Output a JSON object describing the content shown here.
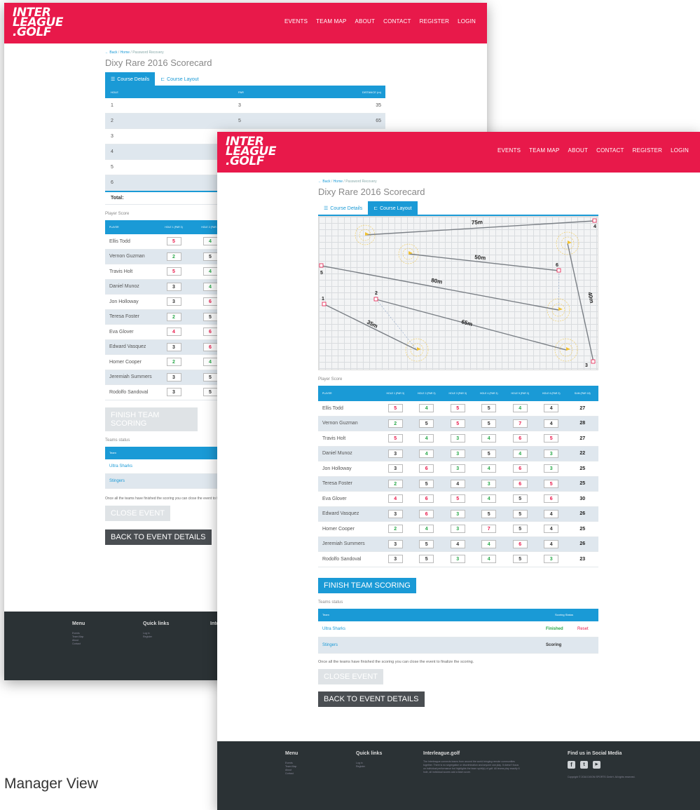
{
  "brand": {
    "line1": "INTER",
    "line2": "LEAGUE",
    "line3": ".GOLF"
  },
  "nav": [
    "EVENTS",
    "TEAM MAP",
    "ABOUT",
    "CONTACT",
    "REGISTER",
    "LOGIN"
  ],
  "breadcrumb": {
    "back": "Back",
    "sep": "/",
    "home": "Home",
    "current": "Password Recovery"
  },
  "page_title": "Dixy Rare 2016 Scorecard",
  "tabs": {
    "details": "Course Details",
    "layout": "Course Layout"
  },
  "course_table": {
    "headers": [
      "HOLE",
      "PAR",
      "DISTANCE (m)"
    ],
    "rows": [
      [
        "1",
        "3",
        "35"
      ],
      [
        "2",
        "5",
        "65"
      ],
      [
        "3",
        "",
        ""
      ],
      [
        "4",
        "",
        ""
      ],
      [
        "5",
        "",
        ""
      ],
      [
        "6",
        "",
        ""
      ]
    ],
    "total_label": "Total:"
  },
  "map_labels": {
    "d1": "75m",
    "d2": "50m",
    "d3": "80m",
    "d4": "65m",
    "d5": "35m",
    "d6": "40m",
    "h1": "1",
    "h2": "2",
    "h3": "3",
    "h4": "4",
    "h5": "5",
    "h6": "6"
  },
  "player_score_label": "Player Score",
  "score_headers": [
    "PLAYER",
    "HOLE 1 (PAR 3)",
    "HOLE 2 (PAR 3)",
    "HOLE 3 (PAR 3)",
    "HOLE 4 (PAR 3)",
    "HOLE 5 (PAR 3)",
    "HOLE 6 (PAR 3)",
    "SUM (PAR 18)"
  ],
  "players": [
    {
      "name": "Ellis Todd",
      "scores": [
        "5",
        "4",
        "5",
        "5",
        "4",
        "4"
      ],
      "colors": [
        "red",
        "green",
        "red",
        "dark",
        "green",
        "dark"
      ],
      "sum": "27"
    },
    {
      "name": "Vernon Guzman",
      "scores": [
        "2",
        "5",
        "5",
        "5",
        "7",
        "4"
      ],
      "colors": [
        "green",
        "dark",
        "red",
        "dark",
        "red",
        "dark"
      ],
      "sum": "28"
    },
    {
      "name": "Travis Holt",
      "scores": [
        "5",
        "4",
        "3",
        "4",
        "6",
        "5"
      ],
      "colors": [
        "red",
        "green",
        "green",
        "green",
        "red",
        "red"
      ],
      "sum": "27"
    },
    {
      "name": "Daniel Munoz",
      "scores": [
        "3",
        "4",
        "3",
        "5",
        "4",
        "3"
      ],
      "colors": [
        "dark",
        "green",
        "green",
        "dark",
        "green",
        "green"
      ],
      "sum": "22"
    },
    {
      "name": "Jon Holloway",
      "scores": [
        "3",
        "6",
        "3",
        "4",
        "6",
        "3"
      ],
      "colors": [
        "dark",
        "red",
        "green",
        "green",
        "red",
        "green"
      ],
      "sum": "25"
    },
    {
      "name": "Teresa Foster",
      "scores": [
        "2",
        "5",
        "4",
        "3",
        "6",
        "5"
      ],
      "colors": [
        "green",
        "dark",
        "dark",
        "green",
        "red",
        "red"
      ],
      "sum": "25"
    },
    {
      "name": "Eva Glover",
      "scores": [
        "4",
        "6",
        "5",
        "4",
        "5",
        "6"
      ],
      "colors": [
        "red",
        "red",
        "red",
        "green",
        "dark",
        "red"
      ],
      "sum": "30"
    },
    {
      "name": "Edward Vasquez",
      "scores": [
        "3",
        "6",
        "3",
        "5",
        "5",
        "4"
      ],
      "colors": [
        "dark",
        "red",
        "green",
        "dark",
        "dark",
        "dark"
      ],
      "sum": "26"
    },
    {
      "name": "Homer Cooper",
      "scores": [
        "2",
        "4",
        "3",
        "7",
        "5",
        "4"
      ],
      "colors": [
        "green",
        "green",
        "green",
        "red",
        "dark",
        "dark"
      ],
      "sum": "25"
    },
    {
      "name": "Jeremiah Summers",
      "scores": [
        "3",
        "5",
        "4",
        "4",
        "6",
        "4"
      ],
      "colors": [
        "dark",
        "dark",
        "dark",
        "green",
        "red",
        "dark"
      ],
      "sum": "26"
    },
    {
      "name": "Rodolfo Sandoval",
      "scores": [
        "3",
        "5",
        "3",
        "4",
        "5",
        "3"
      ],
      "colors": [
        "dark",
        "dark",
        "green",
        "green",
        "dark",
        "green"
      ],
      "sum": "23"
    }
  ],
  "finish_button": "FINISH TEAM SCORING",
  "teams_status_label": "Teams status",
  "teams_headers": [
    "Team",
    "Scoring Status"
  ],
  "teams": [
    {
      "name": "Ultra Sharks",
      "status": "Finished",
      "action": "Reset"
    },
    {
      "name": "Stingers",
      "status": "Scoring",
      "action": ""
    }
  ],
  "close_note": "Once all the teams have finished the scoring you can close the event to finalize the scoring.",
  "close_button": "CLOSE EVENT",
  "back_button": "BACK TO EVENT DETAILS",
  "footer": {
    "menu_title": "Menu",
    "menu_items": [
      "Events",
      "Team Map",
      "About",
      "Contact"
    ],
    "quick_title": "Quick links",
    "quick_items": [
      "Log in",
      "Register"
    ],
    "about_title": "Interleague.golf",
    "about_text": "The Interleague connects teams from around the world bringing remote communities together. There is no segregation or discrimination and anyone can play. It doesn't focus on individual performance but highlights the team spirit(s) of golf. All teams play exactly 6 hole, all individual scores add a team score.",
    "social_title": "Find us in Social Media",
    "copyright": "Copyright © 2016 DIXON SPORTS GmbH. All rights reserved."
  },
  "caption": "Manager View",
  "colors": {
    "brand_red": "#e8194a",
    "accent_blue": "#1a9ad6",
    "footer_bg": "#2b3235",
    "good_green": "#2aa84a"
  }
}
